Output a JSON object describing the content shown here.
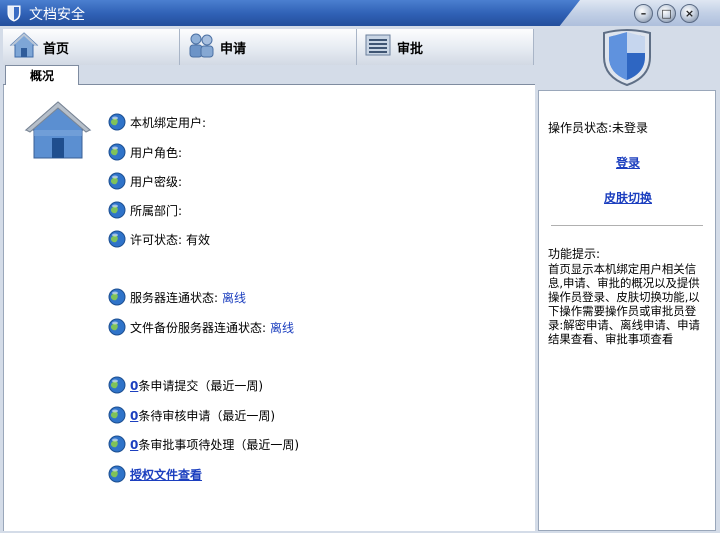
{
  "window": {
    "title": "文档安全",
    "minimize_glyph": "–",
    "maximize_glyph": "□",
    "close_glyph": "×"
  },
  "nav": {
    "tabs": [
      {
        "label": "首页",
        "icon": "home-icon"
      },
      {
        "label": "申请",
        "icon": "users-icon"
      },
      {
        "label": "审批",
        "icon": "list-icon"
      }
    ]
  },
  "subtab": {
    "label": "概况"
  },
  "overview": {
    "bound_user_label": "本机绑定用户:",
    "user_role_label": "用户角色:",
    "user_clearance_label": "用户密级:",
    "department_label": "所属部门:",
    "license_status_label": "许可状态:",
    "license_status_value": "有效",
    "server_status_label": "服务器连通状态:",
    "server_status_value": "离线",
    "backup_server_status_label": "文件备份服务器连通状态:",
    "backup_server_status_value": "离线",
    "submitted_count": "0",
    "submitted_text": "条申请提交（最近一周)",
    "pending_review_count": "0",
    "pending_review_text": "条待审核申请（最近一周)",
    "approval_count": "0",
    "approval_text": "条审批事项待处理（最近一周)",
    "authorized_files_link": "授权文件查看"
  },
  "sidebar": {
    "operator_status": "操作员状态:未登录",
    "login_link": "登录",
    "skin_switch_link": "皮肤切换",
    "tip_label": "功能提示:",
    "tip_text": "首页显示本机绑定用户相关信息,申请、审批的概况以及提供操作员登录、皮肤切换功能,以下操作需要操作员或审批员登录:解密申请、离线申请、申请结果查看、审批事项查看"
  },
  "colors": {
    "title_bar": "#2f60b4",
    "link": "#1c3fbf",
    "frame": "#d4dce8"
  }
}
